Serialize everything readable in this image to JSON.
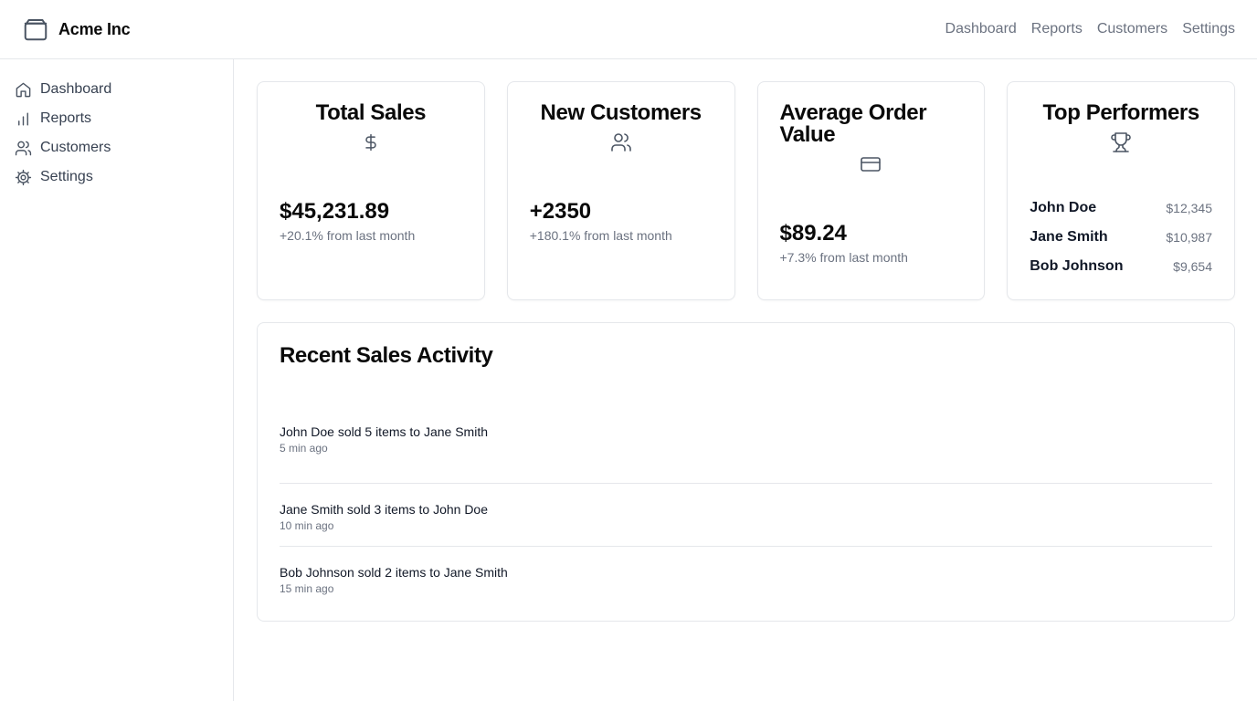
{
  "brand": {
    "name": "Acme Inc",
    "logo_icon": "package-icon"
  },
  "topnav": {
    "items": [
      {
        "label": "Dashboard"
      },
      {
        "label": "Reports"
      },
      {
        "label": "Customers"
      },
      {
        "label": "Settings"
      }
    ]
  },
  "sidebar": {
    "items": [
      {
        "label": "Dashboard",
        "icon": "home-icon"
      },
      {
        "label": "Reports",
        "icon": "bar-chart-icon"
      },
      {
        "label": "Customers",
        "icon": "users-icon"
      },
      {
        "label": "Settings",
        "icon": "gear-icon"
      }
    ]
  },
  "cards": {
    "total_sales": {
      "title": "Total Sales",
      "icon": "dollar-icon",
      "value": "$45,231.89",
      "change": "+20.1% from last month"
    },
    "new_customers": {
      "title": "New Customers",
      "icon": "users-icon",
      "value": "+2350",
      "change": "+180.1% from last month"
    },
    "avg_order": {
      "title": "Average Order Value",
      "icon": "credit-card-icon",
      "value": "$89.24",
      "change": "+7.3% from last month"
    },
    "top_performers": {
      "title": "Top Performers",
      "icon": "trophy-icon",
      "people": [
        {
          "name": "John Doe",
          "value": "$12,345"
        },
        {
          "name": "Jane Smith",
          "value": "$10,987"
        },
        {
          "name": "Bob Johnson",
          "value": "$9,654"
        }
      ]
    }
  },
  "activity": {
    "title": "Recent Sales Activity",
    "items": [
      {
        "text": "John Doe sold 5 items to Jane Smith",
        "time": "5 min ago"
      },
      {
        "text": "Jane Smith sold 3 items to John Doe",
        "time": "10 min ago"
      },
      {
        "text": "Bob Johnson sold 2 items to Jane Smith",
        "time": "15 min ago"
      }
    ]
  },
  "colors": {
    "text": "#0a0a0a",
    "muted": "#6b7280",
    "border": "#e5e7eb",
    "icon": "#4b5563"
  }
}
